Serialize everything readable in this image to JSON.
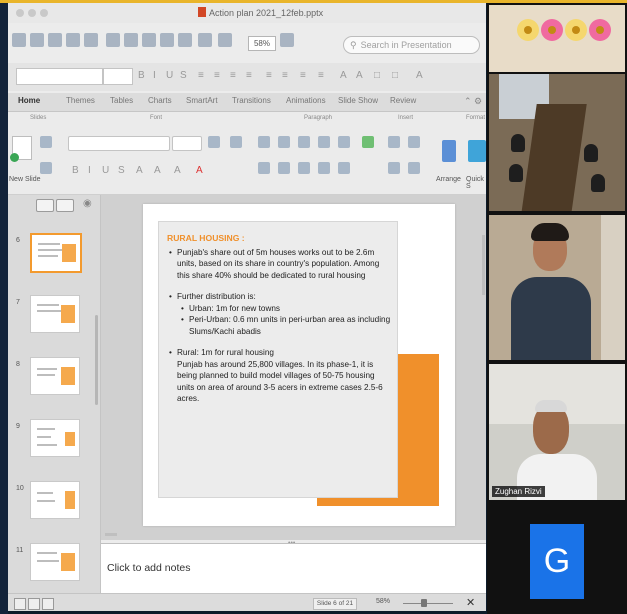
{
  "window": {
    "title": "Action plan 2021_12feb.pptx",
    "search_placeholder": "Search in Presentation",
    "zoom": "58%"
  },
  "ribbon": {
    "tabs": [
      "Home",
      "Themes",
      "Tables",
      "Charts",
      "SmartArt",
      "Transitions",
      "Animations",
      "Slide Show",
      "Review"
    ],
    "groups": [
      "Slides",
      "Font",
      "Paragraph",
      "Insert",
      "Format"
    ],
    "new_slide_label": "New Slide",
    "arrange_label": "Arrange",
    "quick_label": "Quick S"
  },
  "thumbnails": {
    "numbers": [
      "6",
      "7",
      "8",
      "9",
      "10",
      "11"
    ],
    "selected_index": 0
  },
  "slide": {
    "heading": "RURAL HOUSING :",
    "lines": [
      {
        "level": 1,
        "text": "Punjab's share out of 5m houses works out to be 2.6m units, based on its share in country's population. Among this share 40% should be dedicated to rural housing"
      },
      {
        "level": 1,
        "text": "Further distribution is:"
      },
      {
        "level": 2,
        "text": "Urban: 1m for new towns"
      },
      {
        "level": 2,
        "text": "Peri-Urban: 0.6 mn units in peri-urban area as including Slums/Kachi abadis"
      },
      {
        "level": 1,
        "text": "Rural: 1m for rural housing"
      },
      {
        "level": 0,
        "text": "Punjab has around 25,800 villages. In its phase-1, it is being planned to build model villages of 50-75 housing units on area of around 3-5 acers in extreme cases 2.5-6 acres."
      }
    ]
  },
  "notes": {
    "placeholder": "Click to add notes"
  },
  "statusbar": {
    "slide_counter": "Slide 6 of 21",
    "zoom": "58%",
    "fit_glyph": "✕"
  },
  "participants": {
    "named_participant": "Zughan Rizvi",
    "avatar_letter": "G"
  },
  "colors": {
    "accent_orange": "#f0902b",
    "avatar_blue": "#1a73e8",
    "top_accent": "#e9b52b"
  }
}
